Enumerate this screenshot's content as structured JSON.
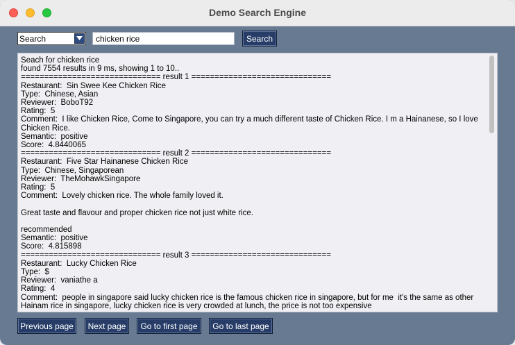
{
  "window": {
    "title": "Demo Search Engine"
  },
  "toolbar": {
    "mode_select": "Search",
    "query_value": "chicken rice",
    "search_label": "Search"
  },
  "results": {
    "text": "Seach for chicken rice\nfound 7554 results in 9 ms, showing 1 to 10..\n============================== result 1 ==============================\nRestaurant:  Sin Swee Kee Chicken Rice\nType:  Chinese, Asian\nReviewer:  BoboT92\nRating:  5\nComment:  I like Chicken Rice, Come to Singapore, you can try a much different taste of Chicken Rice. I m a Hainanese, so I love Chicken Rice.\nSemantic:  positive\nScore:  4.8440065\n============================== result 2 ==============================\nRestaurant:  Five Star Hainanese Chicken Rice\nType:  Chinese, Singaporean\nReviewer:  TheMohawkSingapore\nRating:  5\nComment:  Lovely chicken rice. The whole family loved it.\n\nGreat taste and flavour and proper chicken rice not just white rice.\n\nrecommended\nSemantic:  positive\nScore:  4.815898\n============================== result 3 ==============================\nRestaurant:  Lucky Chicken Rice\nType:  $\nReviewer:  vaniathe a\nRating:  4\nComment:  people in singapore said lucky chicken rice is the famous chicken rice in singapore, but for me  it's the same as other Hainam rice in singapore, lucky chicken rice is very crowded at lunch, the price is not too expensive"
  },
  "pagination": {
    "previous_label": "Previous page",
    "next_label": "Next page",
    "first_label": "Go to first page",
    "last_label": "Go to last page"
  }
}
